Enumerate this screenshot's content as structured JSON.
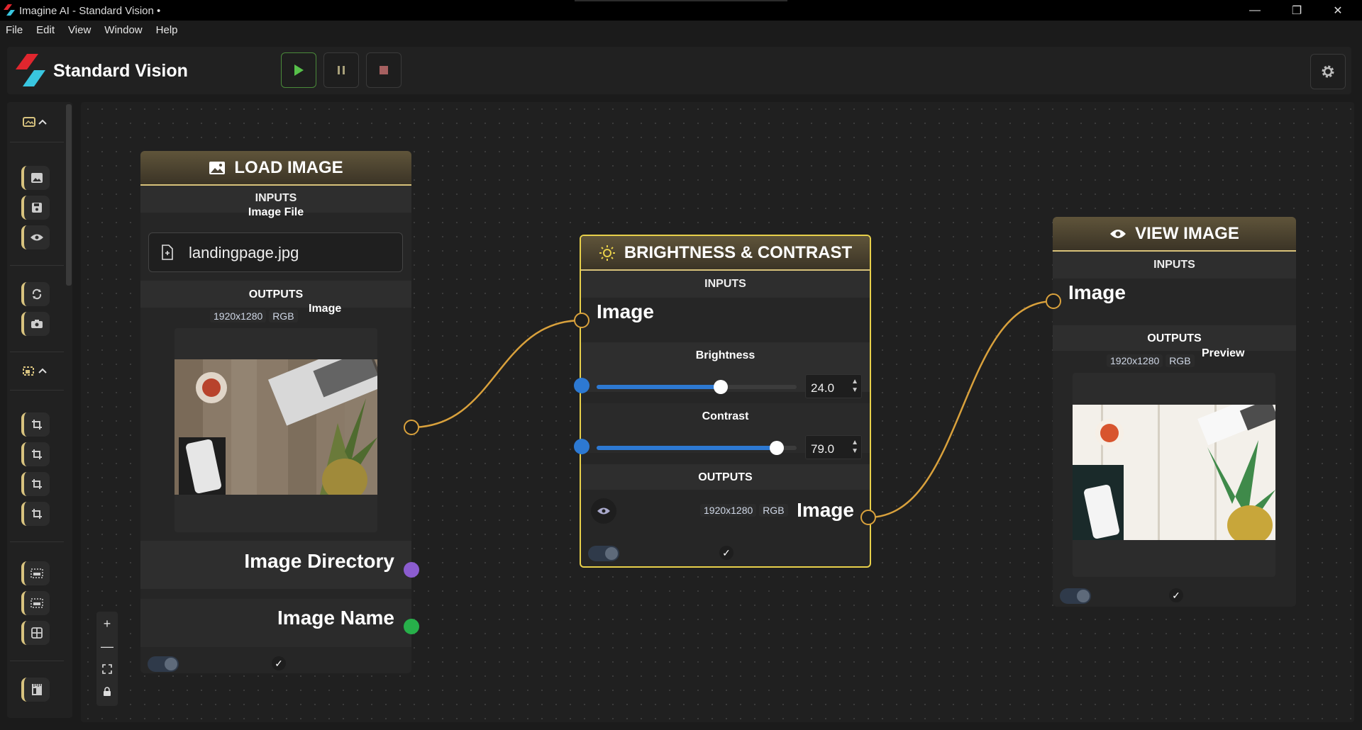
{
  "window": {
    "title": "Imagine AI - Standard Vision •",
    "minimize": "—",
    "maximize": "❐",
    "close": "✕"
  },
  "menu": [
    "File",
    "Edit",
    "View",
    "Window",
    "Help"
  ],
  "toolbar": {
    "app_name": "Standard Vision",
    "play_icon": "play-icon",
    "pause_icon": "pause-icon",
    "stop_icon": "stop-icon",
    "settings_icon": "gear-icon"
  },
  "colors": {
    "accent_gold": "#d8c27a",
    "selected_border": "#e8d04a",
    "wire": "#d9a13c",
    "slider_blue": "#2d79d2",
    "port_purple": "#8b5ccf",
    "port_green": "#27b04a"
  },
  "zoom_controls": {
    "zoom_in": "+",
    "zoom_out": "—",
    "fit": "⛶",
    "lock": "🔒"
  },
  "nodes": {
    "load_image": {
      "title": "LOAD IMAGE",
      "inputs_label": "INPUTS",
      "input_name": "Image File",
      "file_value": "landingpage.jpg",
      "outputs_label": "OUTPUTS",
      "resolution": "1920x1280",
      "mode": "RGB",
      "output_image_label": "Image",
      "output_dir_label": "Image Directory",
      "output_name_label": "Image Name",
      "check": "✓"
    },
    "brightness_contrast": {
      "title": "BRIGHTNESS & CONTRAST",
      "inputs_label": "INPUTS",
      "input_image_label": "Image",
      "brightness_label": "Brightness",
      "brightness_value": "24.0",
      "brightness_level": 0.62,
      "contrast_label": "Contrast",
      "contrast_value": "79.0",
      "contrast_level": 0.9,
      "outputs_label": "OUTPUTS",
      "resolution": "1920x1280",
      "mode": "RGB",
      "output_image_label": "Image",
      "check": "✓"
    },
    "view_image": {
      "title": "VIEW IMAGE",
      "inputs_label": "INPUTS",
      "input_image_label": "Image",
      "outputs_label": "OUTPUTS",
      "resolution": "1920x1280",
      "mode": "RGB",
      "preview_label": "Preview",
      "check": "✓"
    }
  }
}
